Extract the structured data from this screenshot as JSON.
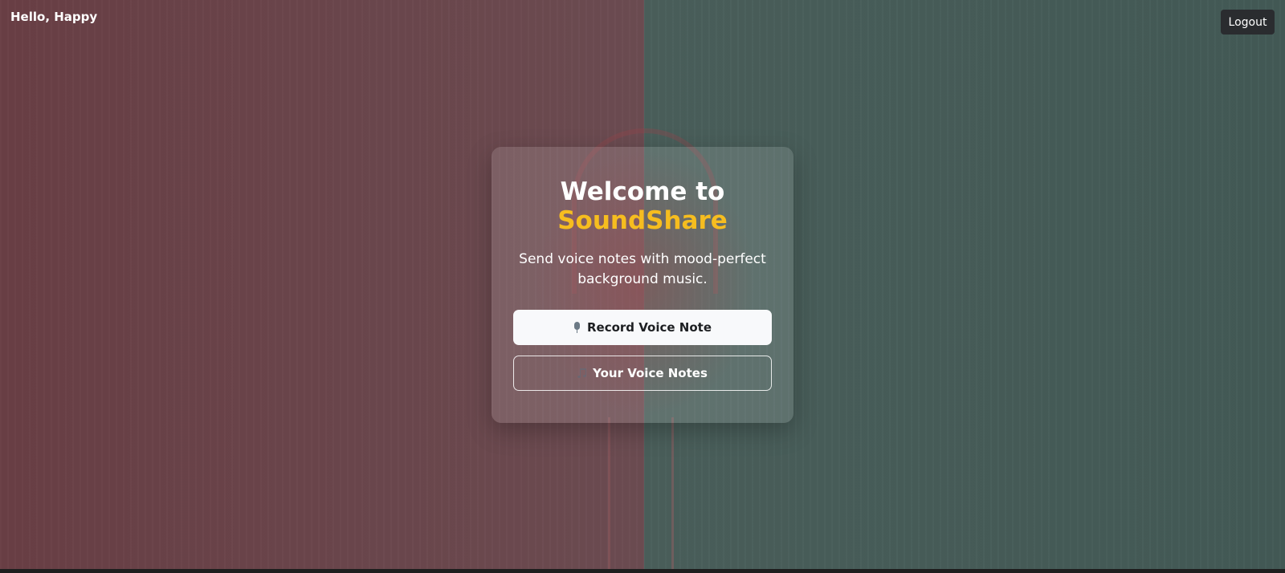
{
  "header": {
    "greeting": "Hello, Happy",
    "logout_label": "Logout"
  },
  "card": {
    "title_line1": "Welcome to",
    "title_line2": "SoundShare",
    "subtitle": "Send voice notes with mood-perfect background music.",
    "record_button_label": "Record Voice Note",
    "record_button_icon": "microphone-icon",
    "notes_button_label": "Your Voice Notes",
    "notes_button_icon": "music-note-icon"
  },
  "colors": {
    "brand_accent": "#f6bd1f",
    "background_left": "#6a3f45",
    "background_right": "#4a5f5b",
    "primary_button_bg": "#f8f9fb",
    "logout_button_bg": "#2a2c2f"
  }
}
